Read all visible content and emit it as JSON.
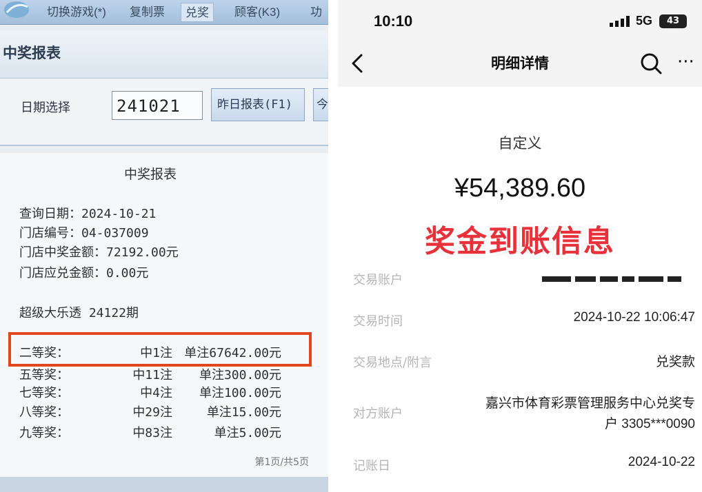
{
  "terminal": {
    "menu": [
      "切换游戏(*)",
      "复制票",
      "兑奖",
      "顾客(K3)",
      "功"
    ],
    "panel_title": "中奖报表",
    "date_label": "日期选择",
    "date_value": "241021",
    "buttons": [
      "昨日报表(F1)",
      "今"
    ],
    "report": {
      "title": "中奖报表",
      "query_date": "查询日期：2024-10-21",
      "store_no": "门店编号：04-037009",
      "store_win": "门店中奖金额：72192.00元",
      "store_payable": "门店应兑金额：0.00元",
      "game": "超级大乐透 24122期",
      "prizes": [
        {
          "name": "二等奖：",
          "count": "中1注",
          "amount": "单注67642.00元"
        },
        {
          "name": "五等奖：",
          "count": "中11注",
          "amount": "单注300.00元"
        },
        {
          "name": "七等奖：",
          "count": "中4注",
          "amount": "单注100.00元"
        },
        {
          "name": "八等奖：",
          "count": "中29注",
          "amount": "单注15.00元"
        },
        {
          "name": "九等奖：",
          "count": "中83注",
          "amount": "单注5.00元"
        }
      ],
      "page": "第1页/共5页"
    }
  },
  "phone": {
    "time": "10:10",
    "network": "5G",
    "battery": "43",
    "nav_title": "明细详情",
    "category": "自定义",
    "amount": "¥54,389.60",
    "overlay_caption": "奖金到账信息",
    "fields": {
      "account_label": "交易账户",
      "time_label": "交易时间",
      "time_value": "2024-10-22 10:06:47",
      "place_label": "交易地点/附言",
      "place_value": "兑奖款",
      "counterparty_label": "对方账户",
      "counterparty_line1": "嘉兴市体育彩票管理服务中心兑奖专",
      "counterparty_line2": "户 3305***0090",
      "booking_label": "记账日",
      "booking_value": "2024-10-22"
    }
  }
}
